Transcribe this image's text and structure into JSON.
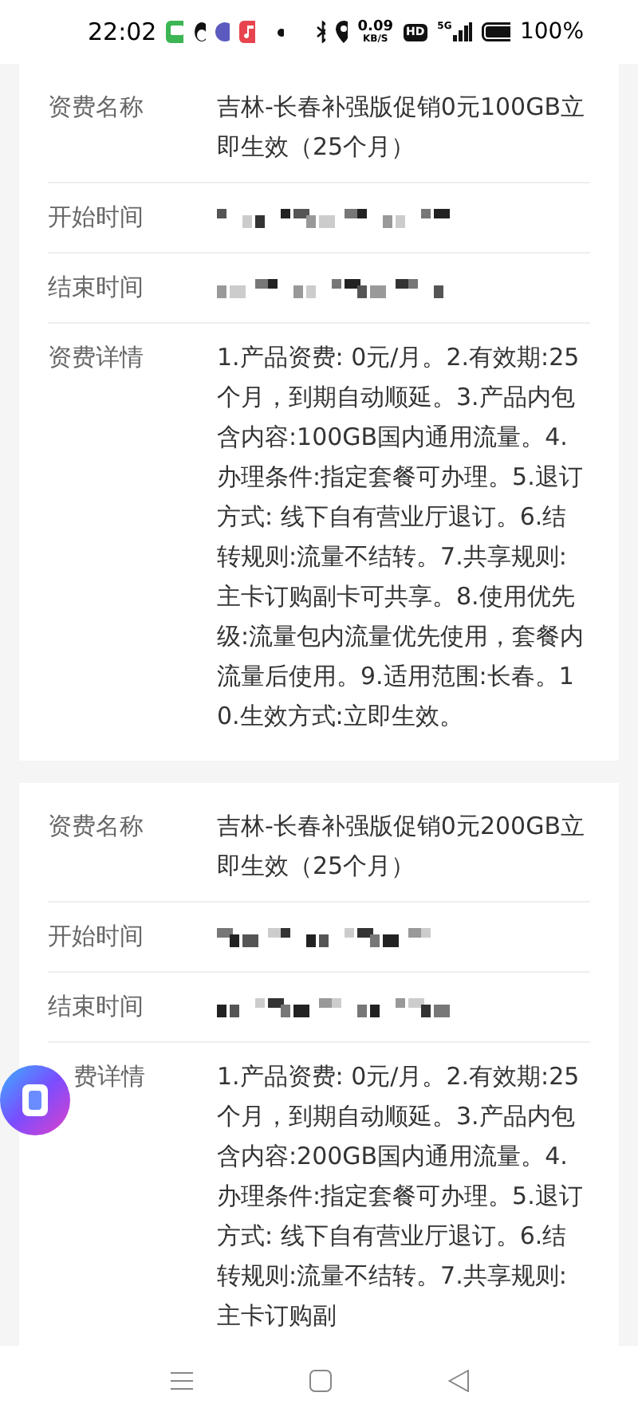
{
  "status_bar": {
    "time": "22:02",
    "speed_value": "0.09",
    "speed_unit": "KB/S",
    "hd": "HD",
    "network": "5G",
    "battery": "100%"
  },
  "cards": [
    {
      "rows": [
        {
          "kind": "text",
          "label": "资费名称",
          "value": "吉林-长春补强版促销0元100GB立即生效（25个月）"
        },
        {
          "kind": "redacted",
          "label": "开始时间"
        },
        {
          "kind": "redacted",
          "label": "结束时间"
        },
        {
          "kind": "text",
          "label": "资费详情",
          "value": "1.产品资费: 0元/月。2.有效期:25个月，到期自动顺延。3.产品内包含内容:100GB国内通用流量。4.办理条件:指定套餐可办理。5.退订方式: 线下自有营业厅退订。6.结转规则:流量不结转。7.共享规则:主卡订购副卡可共享。8.使用优先级:流量包内流量优先使用，套餐内流量后使用。9.适用范围:长春。10.生效方式:立即生效。"
        }
      ]
    },
    {
      "rows": [
        {
          "kind": "text",
          "label": "资费名称",
          "value": "吉林-长春补强版促销0元200GB立即生效（25个月）"
        },
        {
          "kind": "redacted",
          "label": "开始时间"
        },
        {
          "kind": "redacted",
          "label": "结束时间"
        },
        {
          "kind": "text",
          "label": "费详情",
          "covered": true,
          "value": "1.产品资费: 0元/月。2.有效期:25个月，到期自动顺延。3.产品内包含内容:200GB国内通用流量。4.办理条件:指定套餐可办理。5.退订方式: 线下自有营业厅退订。6.结转规则:流量不结转。7.共享规则:主卡订购副"
        }
      ]
    }
  ]
}
